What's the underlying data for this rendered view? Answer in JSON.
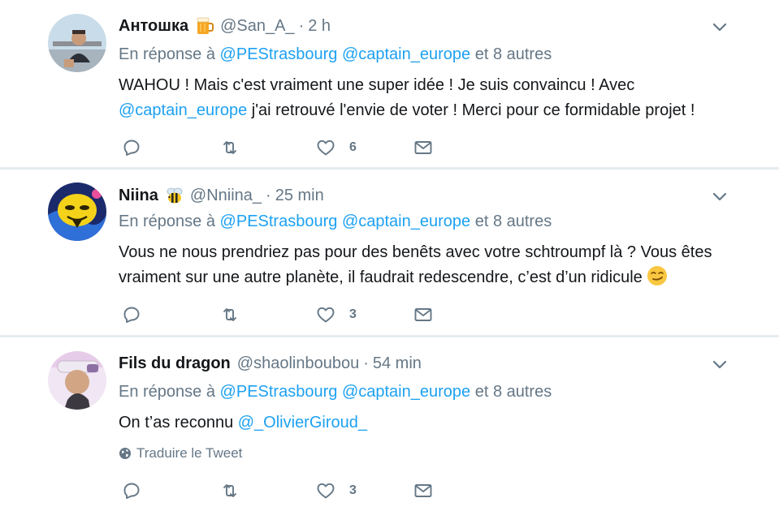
{
  "tweets": [
    {
      "name": "Антошка",
      "name_emoji": "beer-mug",
      "handle": "@San_A_",
      "separator": "·",
      "time": "2 h",
      "reply_prefix": "En réponse à",
      "mention1": "@PEStrasbourg",
      "mention2": "@captain_europe",
      "reply_suffix": "et 8 autres",
      "text_part1": "WAHOU ! Mais c'est vraiment une super idée ! Je suis convaincu ! Avec ",
      "text_mention": "@captain_europe",
      "text_part2": " j'ai retrouvé l'envie de voter ! Merci pour ce formidable projet !",
      "reply_count": "",
      "retweet_count": "",
      "like_count": "6"
    },
    {
      "name": "Niina",
      "name_emoji": "bee",
      "handle": "@Nniina_",
      "separator": "·",
      "time": "25 min",
      "reply_prefix": "En réponse à",
      "mention1": "@PEStrasbourg",
      "mention2": "@captain_europe",
      "reply_suffix": "et 8 autres",
      "text": "Vous ne nous prendriez pas pour des benêts avec votre schtroumpf là ? Vous êtes vraiment sur une autre planète, il faudrait redescendre, c’est d’un ridicule ",
      "text_emoji": "smirking-face",
      "reply_count": "",
      "retweet_count": "",
      "like_count": "3"
    },
    {
      "name": "Fils du dragon",
      "handle": "@shaolinboubou",
      "separator": "·",
      "time": "54 min",
      "reply_prefix": "En réponse à",
      "mention1": "@PEStrasbourg",
      "mention2": "@captain_europe",
      "reply_suffix": "et 8 autres",
      "text": "On t’as reconnu ",
      "text_mention": "@_OlivierGiroud_",
      "translate_label": "Traduire le Tweet",
      "reply_count": "",
      "retweet_count": "",
      "like_count": "3"
    }
  ],
  "colors": {
    "link": "#1da1f2",
    "secondary": "#657786",
    "background": "#e6ecf0"
  }
}
